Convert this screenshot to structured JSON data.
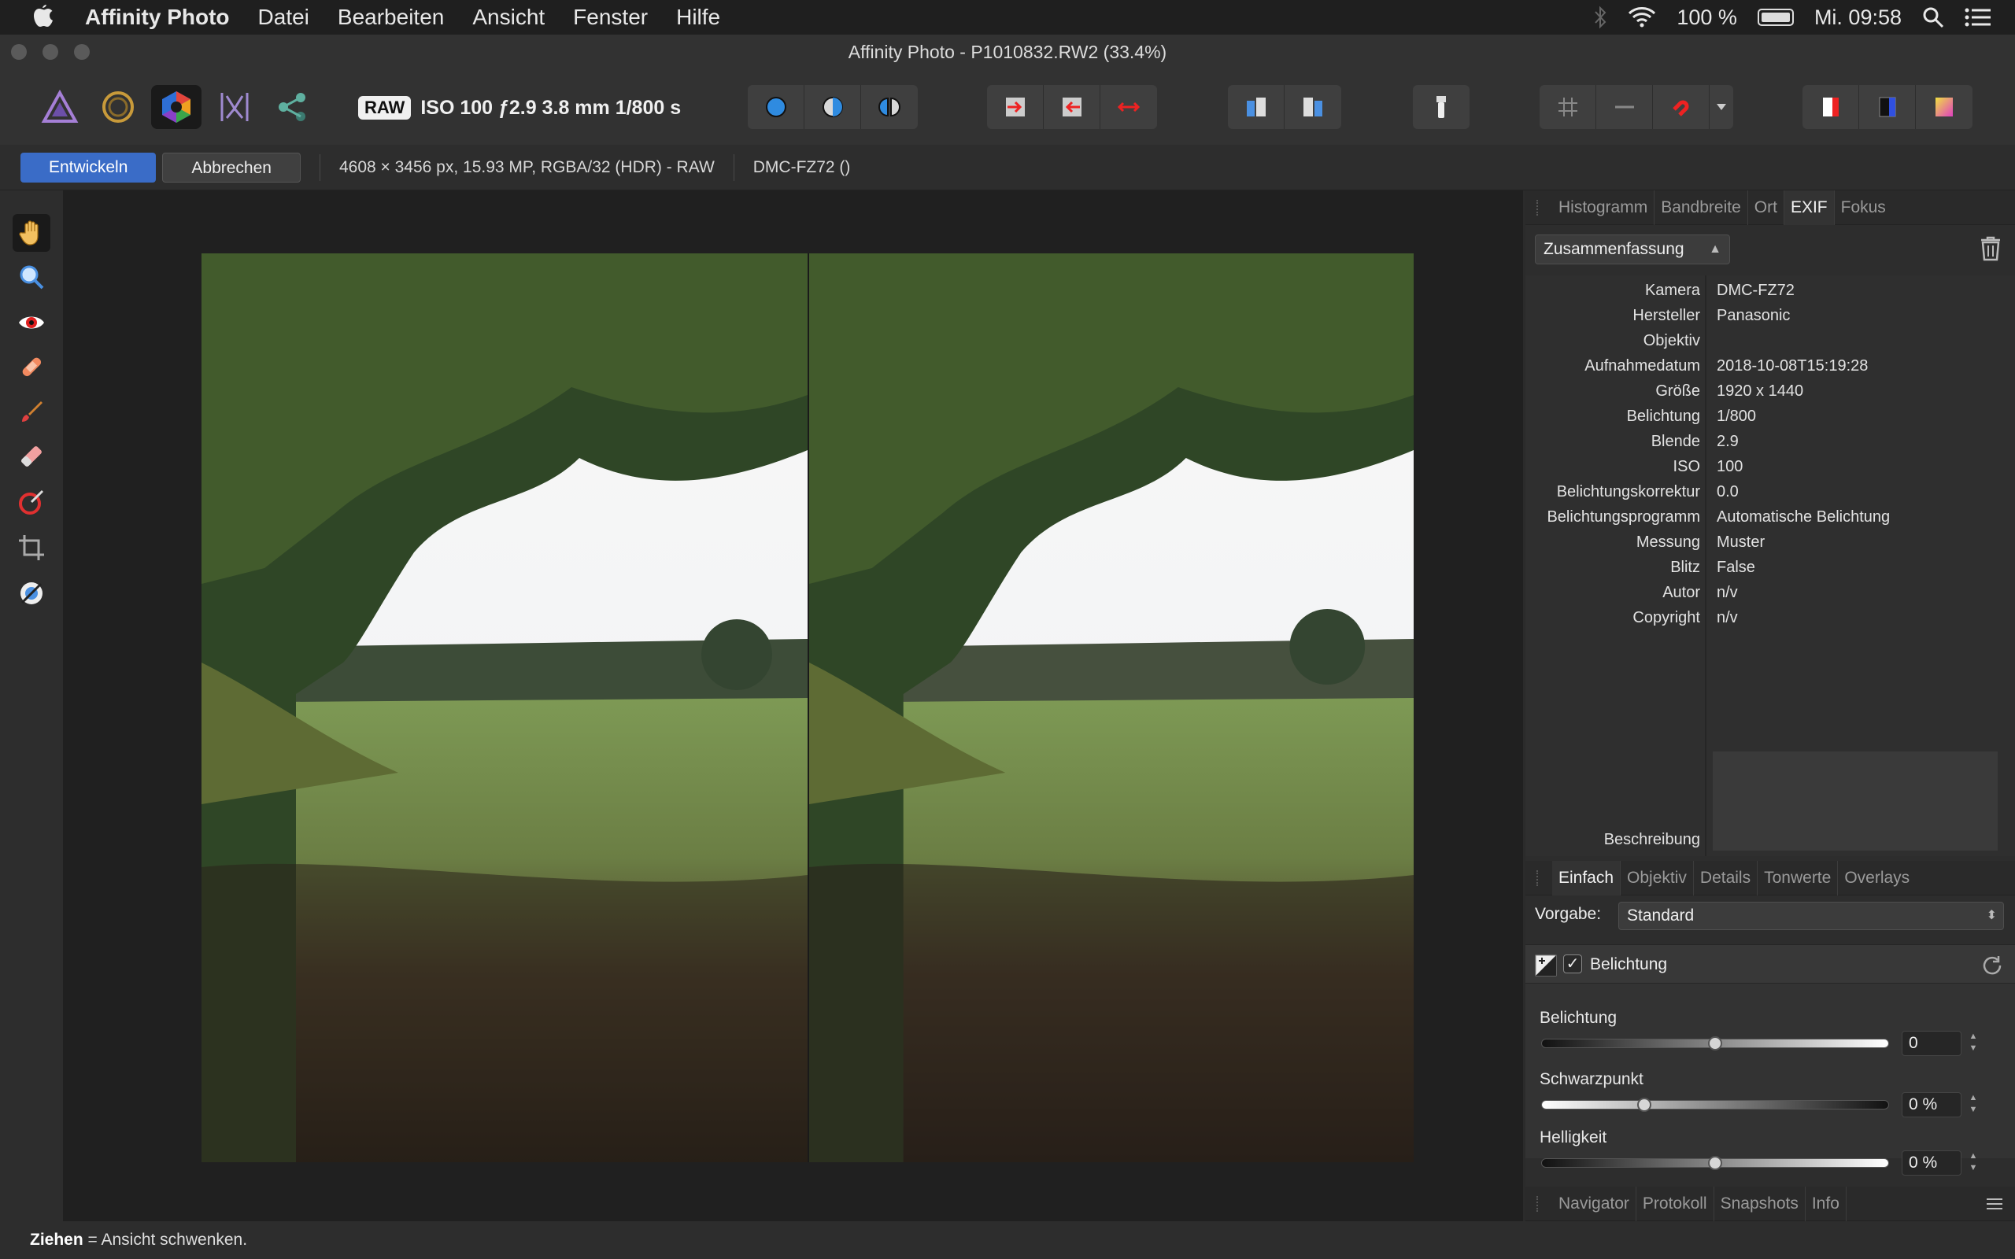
{
  "menubar": {
    "app_name": "Affinity Photo",
    "items": [
      "Datei",
      "Bearbeiten",
      "Ansicht",
      "Fenster",
      "Hilfe"
    ],
    "battery_text": "100 %",
    "clock": "Mi. 09:58"
  },
  "window": {
    "title": "Affinity Photo - P1010832.RW2 (33.4%)"
  },
  "toolbar": {
    "raw_badge": "RAW",
    "exif_summary": "ISO 100 ƒ2.9 3.8 mm 1/800 s",
    "personas": [
      "photo-persona-icon",
      "liquify-persona-icon",
      "develop-persona-icon",
      "tone-mapping-persona-icon",
      "export-persona-icon"
    ],
    "active_persona": "develop-persona-icon"
  },
  "contextbar": {
    "develop_label": "Entwickeln",
    "cancel_label": "Abbrechen",
    "image_info": "4608 × 3456 px, 15.93 MP, RGBA/32 (HDR) - RAW",
    "camera_info": "DMC-FZ72 ()"
  },
  "tools": [
    "hand-icon",
    "zoom-icon",
    "red-eye-icon",
    "blemish-icon",
    "overlay-paint-icon",
    "overlay-erase-icon",
    "overlay-gradient-icon",
    "crop-icon",
    "white-balance-icon"
  ],
  "top_panel": {
    "tabs": [
      "Histogramm",
      "Bandbreite",
      "Ort",
      "EXIF",
      "Fokus"
    ],
    "active_tab": "EXIF",
    "select_value": "Zusammenfassung",
    "exif": [
      {
        "key": "Kamera",
        "value": "DMC-FZ72"
      },
      {
        "key": "Hersteller",
        "value": "Panasonic"
      },
      {
        "key": "Objektiv",
        "value": ""
      },
      {
        "key": "Aufnahmedatum",
        "value": "2018-10-08T15:19:28"
      },
      {
        "key": "Größe",
        "value": "1920 x 1440"
      },
      {
        "key": "Belichtung",
        "value": "1/800"
      },
      {
        "key": "Blende",
        "value": "2.9"
      },
      {
        "key": "ISO",
        "value": "100"
      },
      {
        "key": "Belichtungskorrektur",
        "value": "0.0"
      },
      {
        "key": "Belichtungsprogramm",
        "value": "Automatische Belichtung"
      },
      {
        "key": "Messung",
        "value": "Muster"
      },
      {
        "key": "Blitz",
        "value": "False"
      },
      {
        "key": "Autor",
        "value": "n/v"
      },
      {
        "key": "Copyright",
        "value": "n/v"
      }
    ],
    "description_label": "Beschreibung"
  },
  "develop_panel": {
    "tabs": [
      "Einfach",
      "Objektiv",
      "Details",
      "Tonwerte",
      "Overlays"
    ],
    "active_tab": "Einfach",
    "preset_label": "Vorgabe:",
    "preset_value": "Standard",
    "group_label": "Belichtung",
    "group_enabled": true,
    "sliders": [
      {
        "label": "Belichtung",
        "value_text": "0",
        "fraction": 0.5
      },
      {
        "label": "Schwarzpunkt",
        "value_text": "0 %",
        "fraction": 0.295
      },
      {
        "label": "Helligkeit",
        "value_text": "0 %",
        "fraction": 0.5
      }
    ]
  },
  "bottom_panel": {
    "tabs": [
      "Navigator",
      "Protokoll",
      "Snapshots",
      "Info"
    ]
  },
  "status": {
    "action": "Ziehen",
    "description": "= Ansicht schwenken."
  }
}
